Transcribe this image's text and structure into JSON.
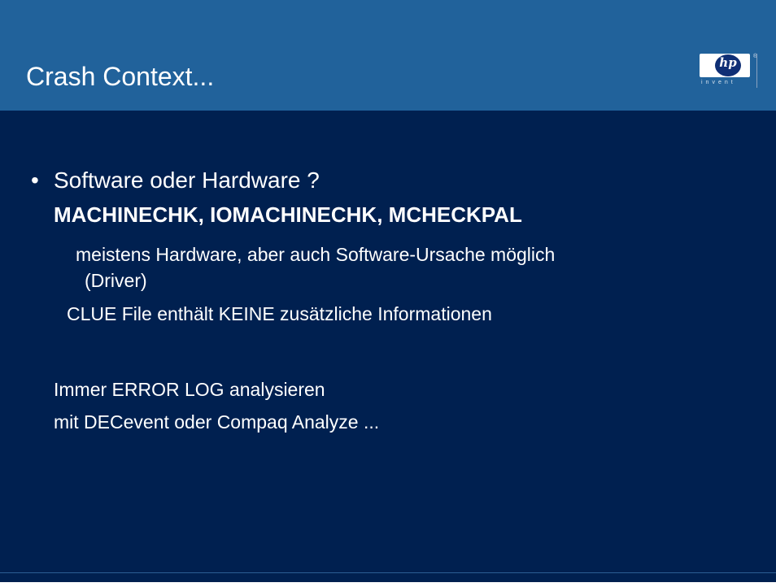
{
  "header": {
    "title": "Crash Context...",
    "logo": {
      "mark": "hp",
      "tagline": "invent",
      "registered": "®"
    }
  },
  "content": {
    "bullet": "•",
    "line1": "Software oder Hardware ?",
    "line2": "MACHINECHK, IOMACHINECHK, MCHECKPAL",
    "line3": "meistens Hardware, aber auch Software-Ursache möglich",
    "line4": "(Driver)",
    "line5": "CLUE File enthält KEINE zusätzliche Informationen",
    "line6": "Immer ERROR LOG analysieren",
    "line7": "mit DECevent oder Compaq Analyze ..."
  },
  "colors": {
    "background": "#002050",
    "header": "#21629b",
    "text": "#ffffff",
    "logo_blue": "#0f2f75"
  }
}
